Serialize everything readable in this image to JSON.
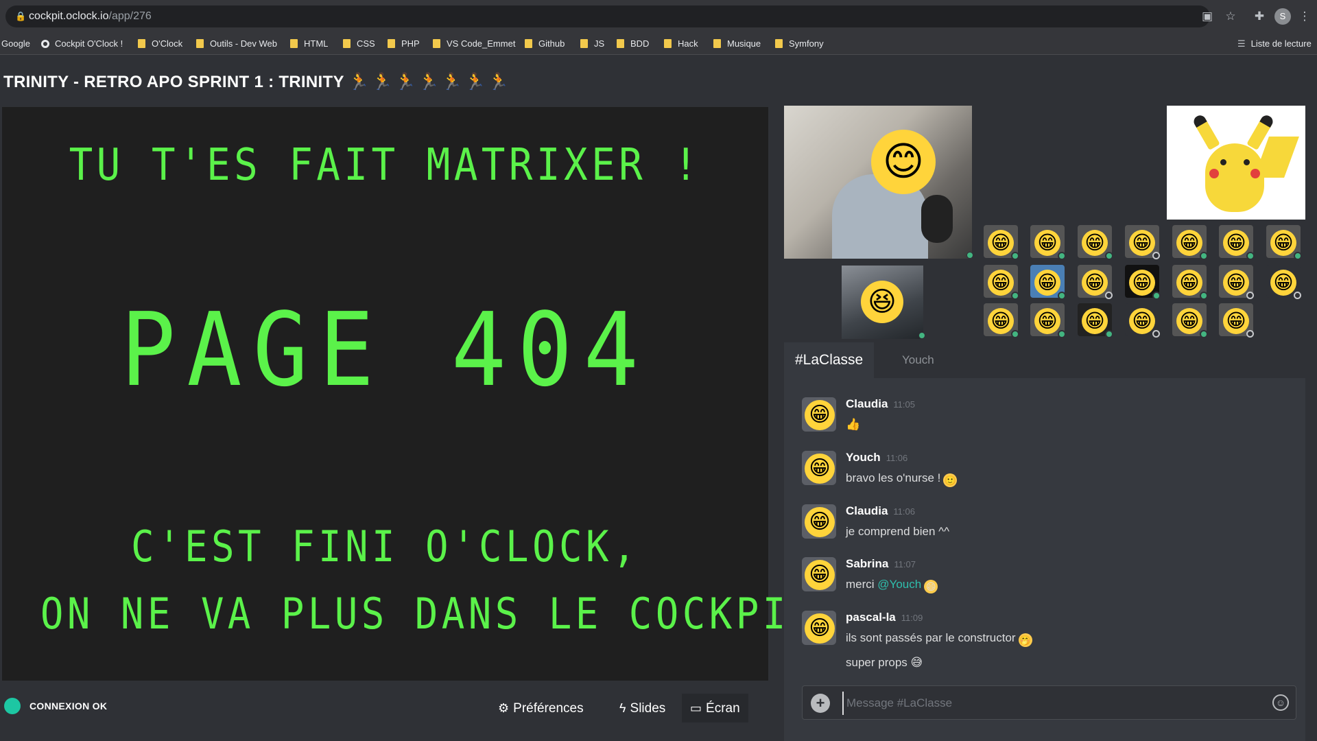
{
  "browser": {
    "url_host": "cockpit.oclock.io",
    "url_path": "/app/276",
    "profile_initial": "S",
    "bookmarks": [
      {
        "label": "Google",
        "icon": "none"
      },
      {
        "label": "Cockpit O'Clock !",
        "icon": "site-icon"
      },
      {
        "label": "O'Clock",
        "icon": "folder-icon"
      },
      {
        "label": "Outils - Dev Web",
        "icon": "folder-icon"
      },
      {
        "label": "HTML",
        "icon": "folder-icon"
      },
      {
        "label": "CSS",
        "icon": "folder-icon"
      },
      {
        "label": "PHP",
        "icon": "folder-icon"
      },
      {
        "label": "VS Code_Emmet",
        "icon": "folder-icon"
      },
      {
        "label": "Github",
        "icon": "folder-icon"
      },
      {
        "label": "JS",
        "icon": "folder-icon"
      },
      {
        "label": "BDD",
        "icon": "folder-icon"
      },
      {
        "label": "Hack",
        "icon": "folder-icon"
      },
      {
        "label": "Musique",
        "icon": "folder-icon"
      },
      {
        "label": "Symfony",
        "icon": "folder-icon"
      }
    ],
    "reading_list": "Liste de lecture"
  },
  "header": {
    "title": "TRINITY - RETRO APO SPRINT 1 : TRINITY",
    "runners": "🏃🏃🏃🏃🏃🏃🏃"
  },
  "stage": {
    "line1": "TU T'ES FAIT MATRIXER !",
    "line2": "PAGE 404",
    "line3": "C'EST FINI O'CLOCK,",
    "line4": "ON NE VA PLUS DANS LE COCKPIT"
  },
  "bottombar": {
    "status": "CONNEXION OK",
    "preferences": "Préférences",
    "slides": "Slides",
    "screen": "Écran"
  },
  "presence": {
    "row1": [
      "on",
      "on",
      "on",
      "off",
      "on",
      "on",
      "on"
    ],
    "row2": [
      "on",
      "on",
      "off",
      "on",
      "on",
      "off",
      "off"
    ],
    "row3": [
      "on",
      "on",
      "on",
      "off",
      "on",
      "off"
    ]
  },
  "chat": {
    "tabs": [
      "#LaClasse",
      "Youch"
    ],
    "messages": [
      {
        "name": "Claudia",
        "time": "11:05",
        "text": "👍",
        "mention": "",
        "text_after": "",
        "emoji": "",
        "extra": ""
      },
      {
        "name": "Youch",
        "time": "11:06",
        "text": "bravo les o'nurse !",
        "mention": "",
        "text_after": "",
        "emoji": "🙂",
        "extra": ""
      },
      {
        "name": "Claudia",
        "time": "11:06",
        "text": "je comprend bien ^^",
        "mention": "",
        "text_after": "",
        "emoji": "",
        "extra": ""
      },
      {
        "name": "Sabrina",
        "time": "11:07",
        "text": "merci ",
        "mention": "@Youch",
        "text_after": "",
        "emoji": "😄",
        "extra": ""
      },
      {
        "name": "pascal-la",
        "time": "11:09",
        "text": "ils sont passés par le constructor",
        "mention": "",
        "text_after": "",
        "emoji": "🤭",
        "extra": "super props 😅"
      }
    ],
    "composer_placeholder": "Message #LaClasse"
  }
}
